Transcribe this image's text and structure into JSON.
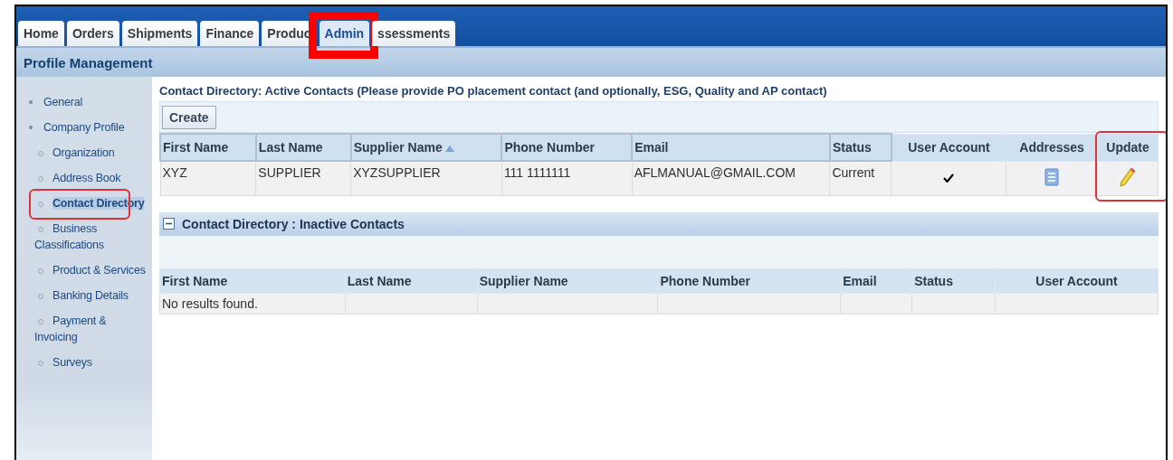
{
  "tabs": [
    {
      "label": "Home",
      "selected": false,
      "highlighted": false
    },
    {
      "label": "Orders",
      "selected": false,
      "highlighted": false
    },
    {
      "label": "Shipments",
      "selected": false,
      "highlighted": false
    },
    {
      "label": "Finance",
      "selected": false,
      "highlighted": false
    },
    {
      "label": "Produc",
      "selected": false,
      "highlighted": false
    },
    {
      "label": "Admin",
      "selected": true,
      "highlighted": true
    },
    {
      "label": "ssessments",
      "selected": false,
      "highlighted": false
    }
  ],
  "subheader": {
    "title": "Profile Management"
  },
  "sidebar": {
    "items": [
      {
        "label": "General",
        "selected": false,
        "highlighted": false
      },
      {
        "label": "Company Profile",
        "selected": false,
        "highlighted": false,
        "children": [
          {
            "label": "Organization",
            "selected": false,
            "highlighted": false
          },
          {
            "label": "Address Book",
            "selected": false,
            "highlighted": false
          },
          {
            "label": "Contact Directory",
            "selected": true,
            "highlighted": true
          },
          {
            "label": "Business Classifications",
            "selected": false,
            "highlighted": false
          },
          {
            "label": "Product & Services",
            "selected": false,
            "highlighted": false
          },
          {
            "label": "Banking Details",
            "selected": false,
            "highlighted": false
          },
          {
            "label": "Payment & Invoicing",
            "selected": false,
            "highlighted": false
          },
          {
            "label": "Surveys",
            "selected": false,
            "highlighted": false
          }
        ]
      }
    ]
  },
  "active_contacts": {
    "title": "Contact Directory: Active Contacts (Please provide PO placement contact (and optionally, ESG, Quality and AP contact)",
    "create_button": "Create",
    "columns": [
      {
        "label": "First Name",
        "kind": "text",
        "sorted": false,
        "highlighted": false
      },
      {
        "label": "Last Name",
        "kind": "text",
        "sorted": false,
        "highlighted": false
      },
      {
        "label": "Supplier Name",
        "kind": "text",
        "sorted": true,
        "highlighted": false
      },
      {
        "label": "Phone Number",
        "kind": "text",
        "sorted": false,
        "highlighted": false
      },
      {
        "label": "Email",
        "kind": "text",
        "sorted": false,
        "highlighted": false
      },
      {
        "label": "Status",
        "kind": "text",
        "sorted": false,
        "highlighted": false
      },
      {
        "label": "User Account",
        "kind": "check",
        "sorted": false,
        "highlighted": false
      },
      {
        "label": "Addresses",
        "kind": "addresses",
        "sorted": false,
        "highlighted": false
      },
      {
        "label": "Update",
        "kind": "update",
        "sorted": false,
        "highlighted": true
      }
    ],
    "rows": [
      {
        "cells": [
          "XYZ",
          "SUPPLIER",
          "XYZSUPPLIER",
          "111 1111111",
          "AFLMANUAL@GMAIL.COM",
          "Current"
        ],
        "user_account": true
      }
    ]
  },
  "inactive_contacts": {
    "title": "Contact Directory : Inactive Contacts",
    "expanded": true,
    "columns": [
      "First Name",
      "Last Name",
      "Supplier Name",
      "Phone Number",
      "Email",
      "Status",
      "User Account"
    ],
    "empty_message": "No results found."
  }
}
